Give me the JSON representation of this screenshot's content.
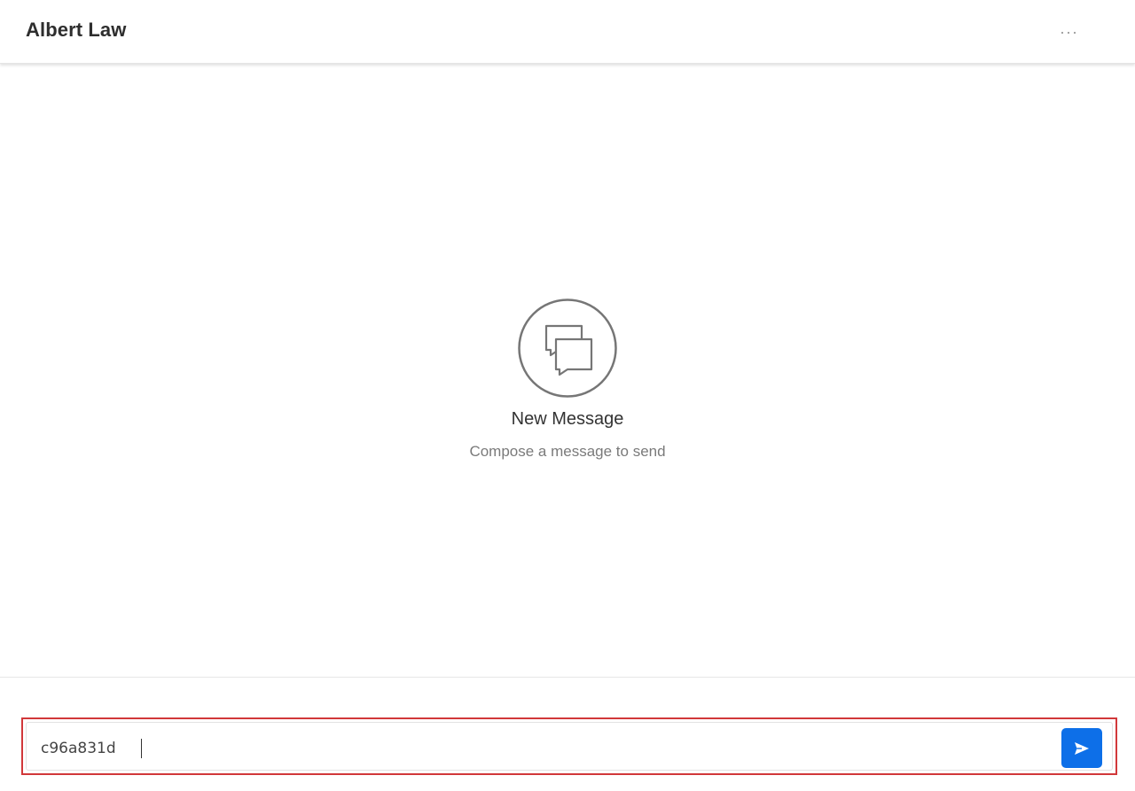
{
  "header": {
    "title": "Albert Law",
    "more_icon": "ellipsis-icon"
  },
  "empty_state": {
    "icon": "chat-bubbles-icon",
    "title": "New Message",
    "subtitle": "Compose a message to send"
  },
  "composer": {
    "input_value": "c96a831d",
    "send_icon": "send-icon",
    "highlight_color": "#d1383a",
    "send_button_color": "#0d6fe8"
  }
}
